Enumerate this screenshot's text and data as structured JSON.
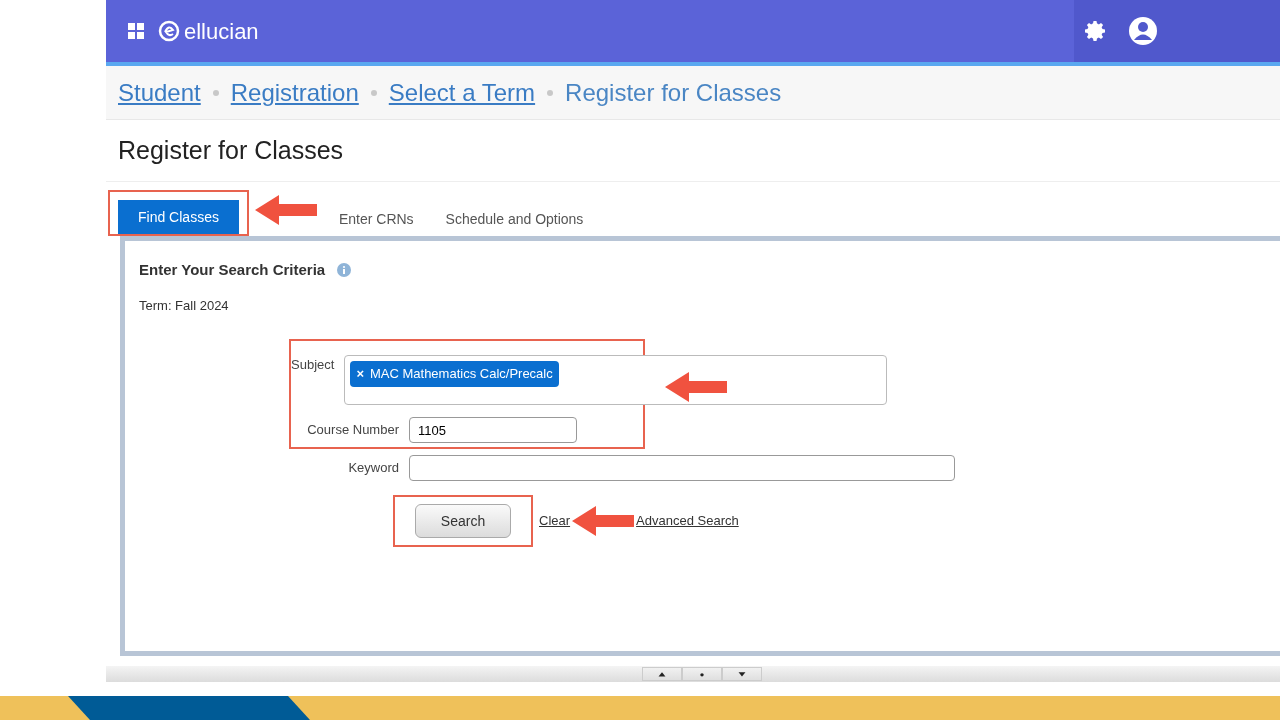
{
  "header": {
    "brand": "ellucian"
  },
  "breadcrumb": [
    {
      "label": "Student",
      "link": true
    },
    {
      "label": "Registration",
      "link": true
    },
    {
      "label": "Select a Term",
      "link": true
    },
    {
      "label": "Register for Classes",
      "link": false
    }
  ],
  "page_title": "Register for Classes",
  "tabs": [
    {
      "label": "Find Classes",
      "selected": true
    },
    {
      "label": "Enter CRNs",
      "selected": false
    },
    {
      "label": "Schedule and Options",
      "selected": false
    }
  ],
  "panel": {
    "heading": "Enter Your Search Criteria",
    "term": "Term: Fall 2024",
    "subject": {
      "label": "Subject",
      "chips": [
        "MAC Mathematics Calc/Precalc"
      ],
      "chip_remove": "×"
    },
    "course_number": {
      "label": "Course Number",
      "value": "1105"
    },
    "keyword": {
      "label": "Keyword"
    },
    "search_button": "Search",
    "links": [
      "Clear",
      "Advanced Search"
    ]
  }
}
